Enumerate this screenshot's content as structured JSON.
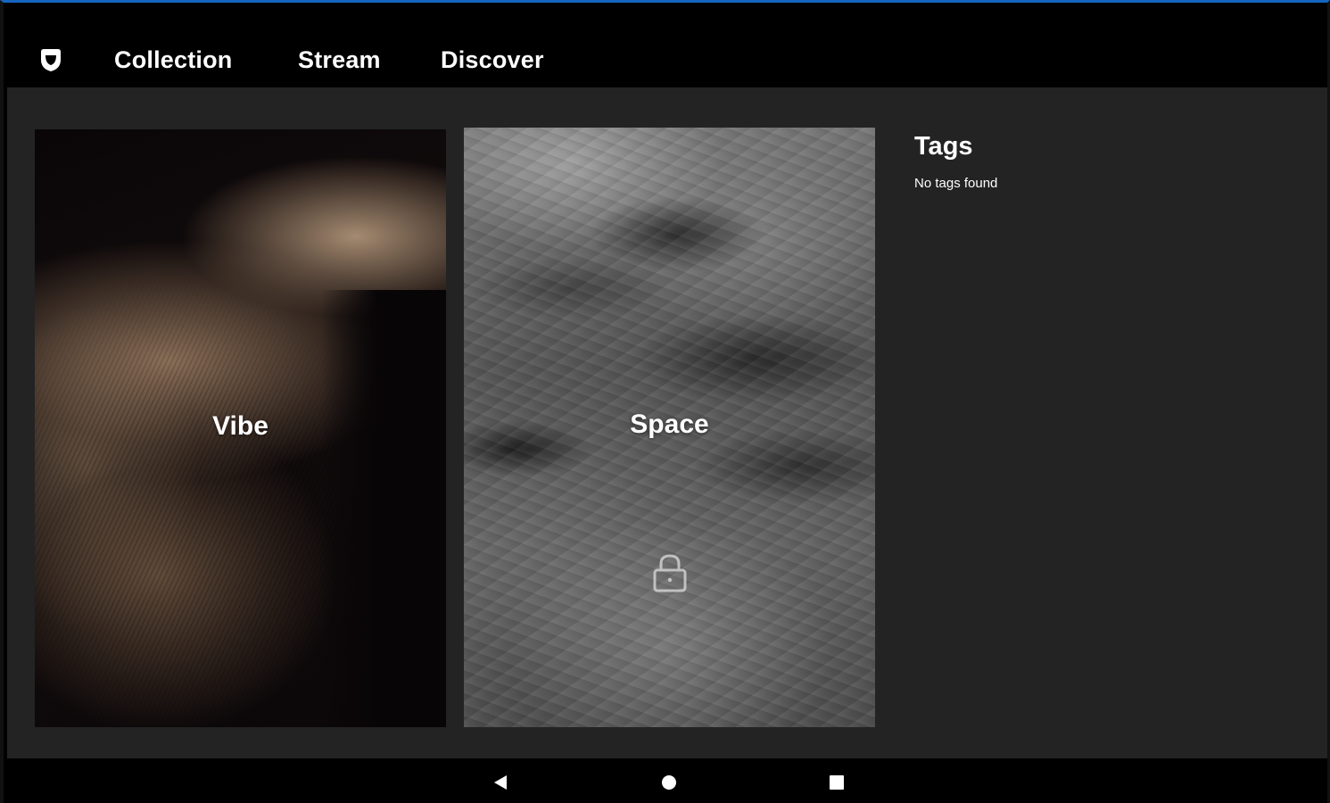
{
  "tabs": [
    {
      "label": "Collection",
      "active": true
    },
    {
      "label": "Stream",
      "active": false
    },
    {
      "label": "Discover",
      "active": false
    }
  ],
  "cards": [
    {
      "label": "Vibe",
      "locked": false
    },
    {
      "label": "Space",
      "locked": true,
      "icon": "lock-icon"
    }
  ],
  "tags": {
    "title": "Tags",
    "empty_message": "No tags found"
  },
  "icons": {
    "logo": "shield-logo-icon",
    "nav_back": "back-triangle-icon",
    "nav_home": "home-circle-icon",
    "nav_recents": "recents-square-icon"
  },
  "colors": {
    "top_accent": "#1565c0",
    "topbar_bg": "#000000",
    "content_bg": "#232323",
    "text": "#ffffff"
  }
}
